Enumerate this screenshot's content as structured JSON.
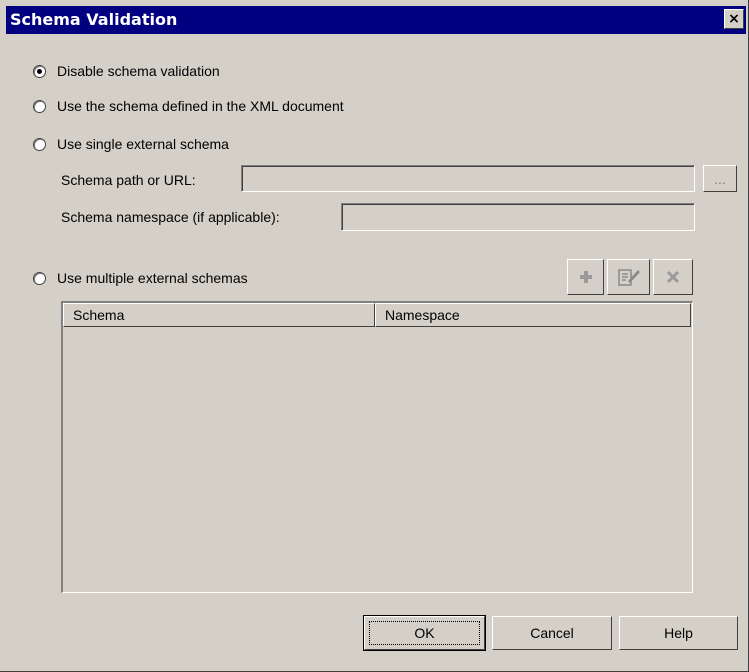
{
  "dialog": {
    "title": "Schema Validation",
    "close_glyph": "×"
  },
  "options": {
    "disable": "Disable schema validation",
    "use_xml": "Use the schema defined in the XML document",
    "single": "Use single external schema",
    "multiple": "Use multiple external schemas"
  },
  "single_schema": {
    "path_label": "Schema path or URL:",
    "path_value": "",
    "browse_label": "...",
    "namespace_label": "Schema namespace (if applicable):",
    "namespace_value": ""
  },
  "multi_schema": {
    "toolbar": {
      "add_icon": "plus-icon",
      "edit_icon": "edit-icon",
      "delete_icon": "delete-icon"
    },
    "columns": [
      "Schema",
      "Namespace"
    ],
    "rows": []
  },
  "buttons": {
    "ok": "OK",
    "cancel": "Cancel",
    "help": "Help"
  },
  "selected_option": "disable"
}
